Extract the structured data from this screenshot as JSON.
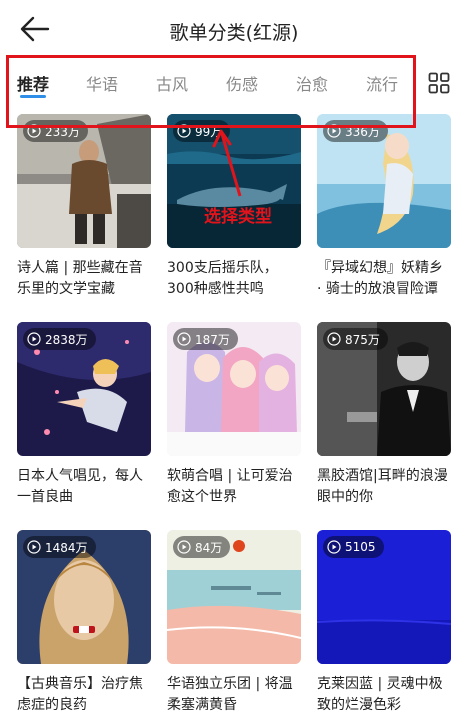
{
  "header": {
    "title": "歌单分类(红源)"
  },
  "tabs": [
    {
      "label": "推荐",
      "active": true
    },
    {
      "label": "华语",
      "active": false
    },
    {
      "label": "古风",
      "active": false
    },
    {
      "label": "伤感",
      "active": false
    },
    {
      "label": "治愈",
      "active": false
    },
    {
      "label": "流行",
      "active": false
    }
  ],
  "annotation": {
    "text": "选择类型",
    "color": "#e1141b"
  },
  "playlists": [
    {
      "title": "诗人篇 | 那些藏在音乐里的文学宝藏",
      "plays": "233万"
    },
    {
      "title": "300支后摇乐队，300种感性共鸣",
      "plays": "99万"
    },
    {
      "title": "『异域幻想』妖精乡 · 骑士的放浪冒险谭",
      "plays": "336万"
    },
    {
      "title": "日本人气唱见，每人一首良曲",
      "plays": "2838万"
    },
    {
      "title": "软萌合唱 | 让可爱治愈这个世界",
      "plays": "187万"
    },
    {
      "title": "黑胶酒馆|耳畔的浪漫眼中的你",
      "plays": "875万"
    },
    {
      "title": "【古典音乐】治疗焦虑症的良药",
      "plays": "1484万"
    },
    {
      "title": "华语独立乐团 | 将温柔塞满黄昏",
      "plays": "84万"
    },
    {
      "title": "克莱因蓝 | 灵魂中极致的烂漫色彩",
      "plays": "5105"
    }
  ],
  "colors": {
    "accent": "#2f8fe8",
    "klein_blue": "#1b1fd6"
  }
}
